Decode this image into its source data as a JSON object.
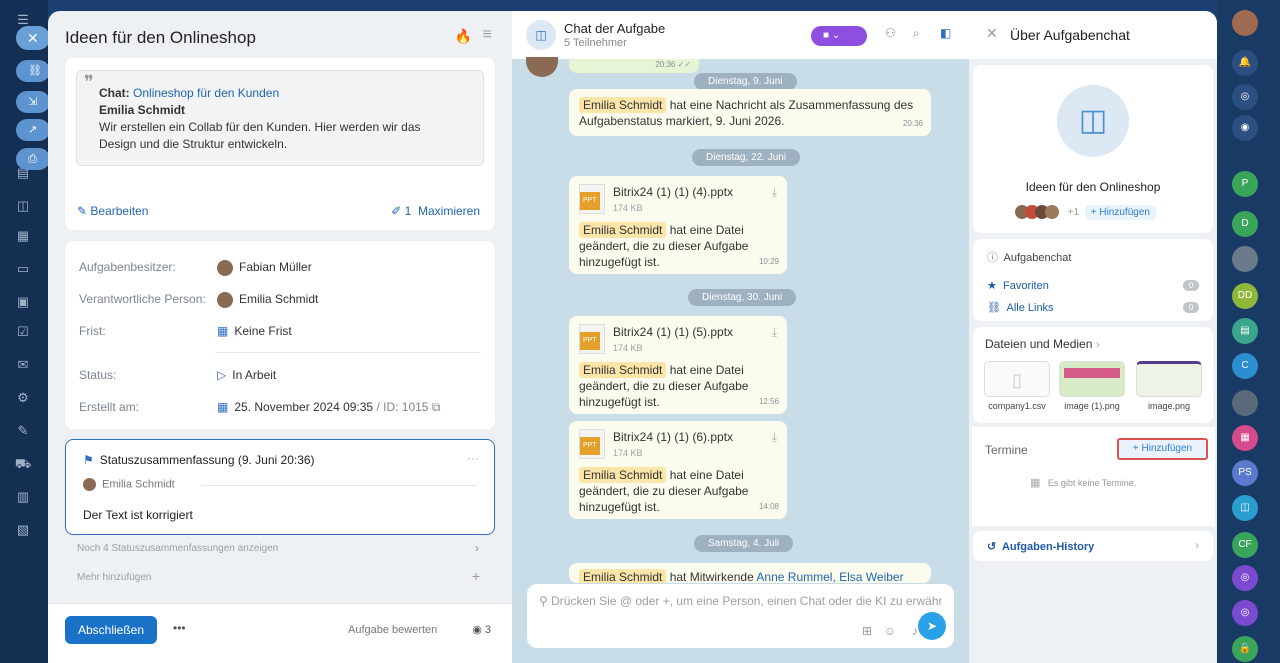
{
  "task": {
    "title": "Ideen für den Onlineshop",
    "quote": {
      "chat_prefix": "Chat:",
      "chat_name": "Onlineshop für den Kunden",
      "author": "Emilia Schmidt",
      "text": "Wir erstellen ein Collab für den Kunden. Hier werden wir das Design und die Struktur entwickeln."
    },
    "edit_label": "Bearbeiten",
    "attach_count": "1",
    "maximize_label": "Maximieren",
    "fields": {
      "owner_label": "Aufgabenbesitzer:",
      "owner": "Fabian Müller",
      "responsible_label": "Verantwortliche Person:",
      "responsible": "Emilia Schmidt",
      "deadline_label": "Frist:",
      "deadline": "Keine Frist",
      "status_label": "Status:",
      "status": "In Arbeit",
      "created_label": "Erstellt am:",
      "created": "25. November 2024 09:35",
      "id": "/ ID: 1015"
    },
    "summary": {
      "title": "Statuszusammenfassung (9. Juni 20:36)",
      "author": "Emilia Schmidt",
      "text": "Der Text ist korrigiert"
    },
    "more_summaries": "Noch 4 Statuszusammenfassungen anzeigen",
    "add_more": "Mehr hinzufügen",
    "complete_label": "Abschließen",
    "rate_label": "Aufgabe bewerten",
    "views": "3"
  },
  "chat": {
    "title": "Chat der Aufgabe",
    "members": "5 Teilnehmer",
    "top_time": "20:36",
    "messages": [
      {
        "date": "Dienstag, 9. Juni",
        "name": "Emilia Schmidt",
        "text": "hat eine Nachricht als Zusammenfassung des Aufgabenstatus markiert, 9. Juni 2026.",
        "time": "20:36"
      },
      {
        "date": "Dienstag, 22. Juni",
        "file": "Bitrix24 (1) (1) (4).pptx",
        "size": "174 KB",
        "name": "Emilia Schmidt",
        "text": "hat eine Datei geändert, die zu dieser Aufgabe hinzugefügt ist.",
        "time": "10:29"
      },
      {
        "date": "Dienstag, 30. Juni",
        "file": "Bitrix24 (1) (1) (5).pptx",
        "size": "174 KB",
        "name": "Emilia Schmidt",
        "text": "hat eine Datei geändert, die zu dieser Aufgabe hinzugefügt ist.",
        "time": "12:56"
      },
      {
        "file": "Bitrix24 (1) (1) (6).pptx",
        "size": "174 KB",
        "name": "Emilia Schmidt",
        "text": "hat eine Datei geändert, die zu dieser Aufgabe hinzugefügt ist.",
        "time": "14:08"
      }
    ],
    "last_date": "Samstag, 4. Juli",
    "last_name": "Emilia Schmidt",
    "last_text": "hat Mitwirkende",
    "last_links": "Anne Rummel, Elsa Weiber",
    "input_placeholder": "Drücken Sie @ oder +, um eine Person, einen Chat oder die KI zu erwähne",
    "ppt_label": "PPT"
  },
  "about": {
    "title": "Über Aufgabenchat",
    "name": "Ideen für den Onlineshop",
    "extra_members": "+1",
    "add_label": "+ Hinzufügen",
    "type": "Aufgabenchat",
    "favorites": "Favoriten",
    "favorites_count": "0",
    "links": "Alle Links",
    "links_count": "0",
    "files_title": "Dateien und Medien",
    "files": [
      "company1.csv",
      "image (1).png",
      "image.png"
    ],
    "events_title": "Termine",
    "events_add": "+ Hinzufügen",
    "no_events": "Es gibt keine Termine.",
    "history": "Aufgaben-History"
  },
  "colors": {
    "accent": "#2f6fc2",
    "video": "#8d4fe0",
    "highlight": "#d9534f"
  }
}
